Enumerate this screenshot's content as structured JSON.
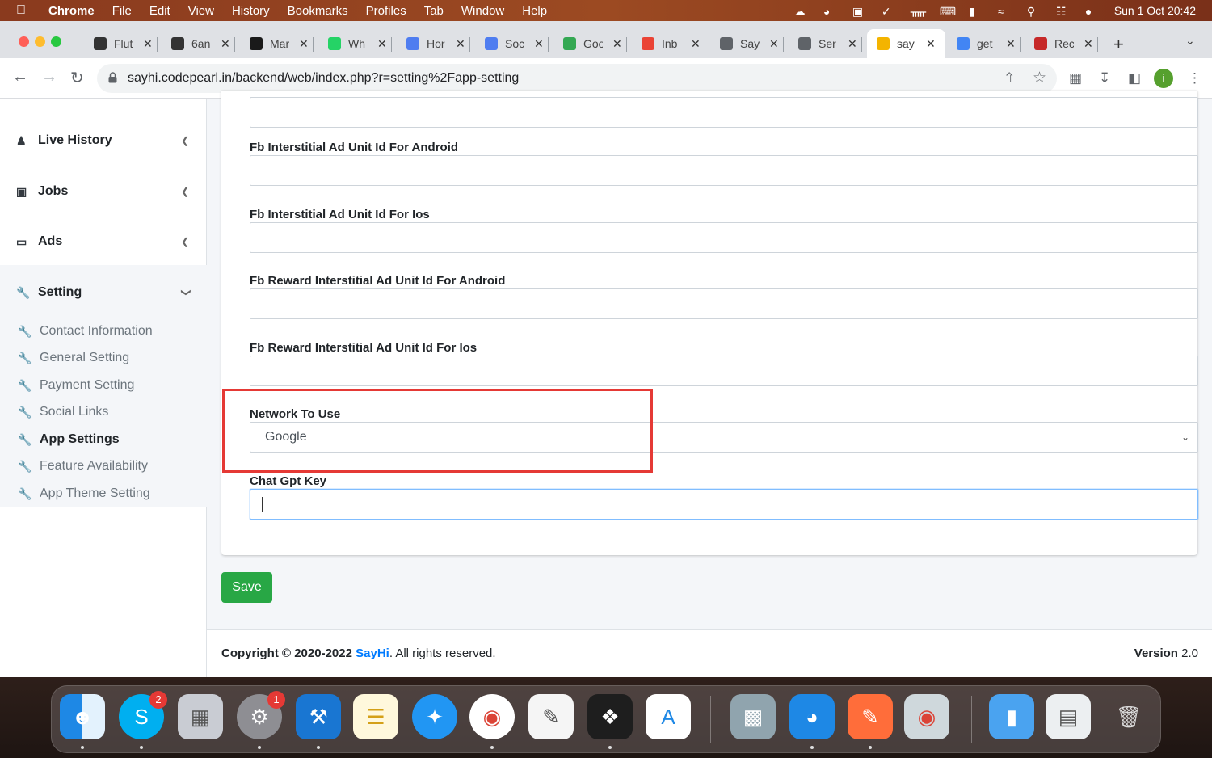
{
  "menubar": {
    "app": "Chrome",
    "items": [
      "File",
      "Edit",
      "View",
      "History",
      "Bookmarks",
      "Profiles",
      "Tab",
      "Window",
      "Help"
    ],
    "clock": "Sun 1 Oct  20:42"
  },
  "tabs": [
    {
      "title": "Flut",
      "color": "#333333"
    },
    {
      "title": "6an",
      "color": "#333333"
    },
    {
      "title": "Mar",
      "color": "#1a1a1a"
    },
    {
      "title": "Wh",
      "color": "#25d366"
    },
    {
      "title": "Hor",
      "color": "#4f7df0"
    },
    {
      "title": "Soc",
      "color": "#4f7df0"
    },
    {
      "title": "Goo",
      "color": "#34a853"
    },
    {
      "title": "Inb",
      "color": "#ea4335"
    },
    {
      "title": "Say",
      "color": "#5f6368"
    },
    {
      "title": "Ser",
      "color": "#5f6368"
    },
    {
      "title": "say",
      "color": "#f4b400",
      "active": true
    },
    {
      "title": "get",
      "color": "#4285f4"
    },
    {
      "title": "Rec",
      "color": "#c62828"
    }
  ],
  "toolbar": {
    "url": "sayhi.codepearl.in/backend/web/index.php?r=setting%2Fapp-setting",
    "profile_initial": "i"
  },
  "sidebar": {
    "main": [
      {
        "label": "Live History",
        "icon": "user-icon"
      },
      {
        "label": "Jobs",
        "icon": "briefcase-icon"
      },
      {
        "label": "Ads",
        "icon": "monitor-icon"
      },
      {
        "label": "Setting",
        "icon": "wrench-icon"
      }
    ],
    "sub": [
      {
        "label": "Contact Information"
      },
      {
        "label": "General Setting"
      },
      {
        "label": "Payment Setting"
      },
      {
        "label": "Social Links"
      },
      {
        "label": "App Settings",
        "active": true
      },
      {
        "label": "Feature Availability"
      },
      {
        "label": "App Theme Setting"
      }
    ]
  },
  "form": {
    "fields": [
      {
        "label": "Fb Interstitial Ad Unit Id For Android",
        "value": ""
      },
      {
        "label": "Fb Interstitial Ad Unit Id For Ios",
        "value": ""
      },
      {
        "label": "Fb Reward Interstitial Ad Unit Id For Android",
        "value": ""
      },
      {
        "label": "Fb Reward Interstitial Ad Unit Id For Ios",
        "value": ""
      }
    ],
    "network_label": "Network To Use",
    "network_value": "Google",
    "chatgpt_label": "Chat Gpt Key",
    "chatgpt_value": "",
    "save_label": "Save"
  },
  "footer": {
    "copyright_prefix": "Copyright © 2020-2022 ",
    "brand": "SayHi",
    "suffix": ". All rights reserved.",
    "version_label": "Version",
    "version_value": "2.0"
  },
  "dock": {
    "skype_badge": "2",
    "settings_badge": "1"
  },
  "colors": {
    "accent": "#007bff",
    "save": "#28a745",
    "highlight": "#e53935"
  }
}
